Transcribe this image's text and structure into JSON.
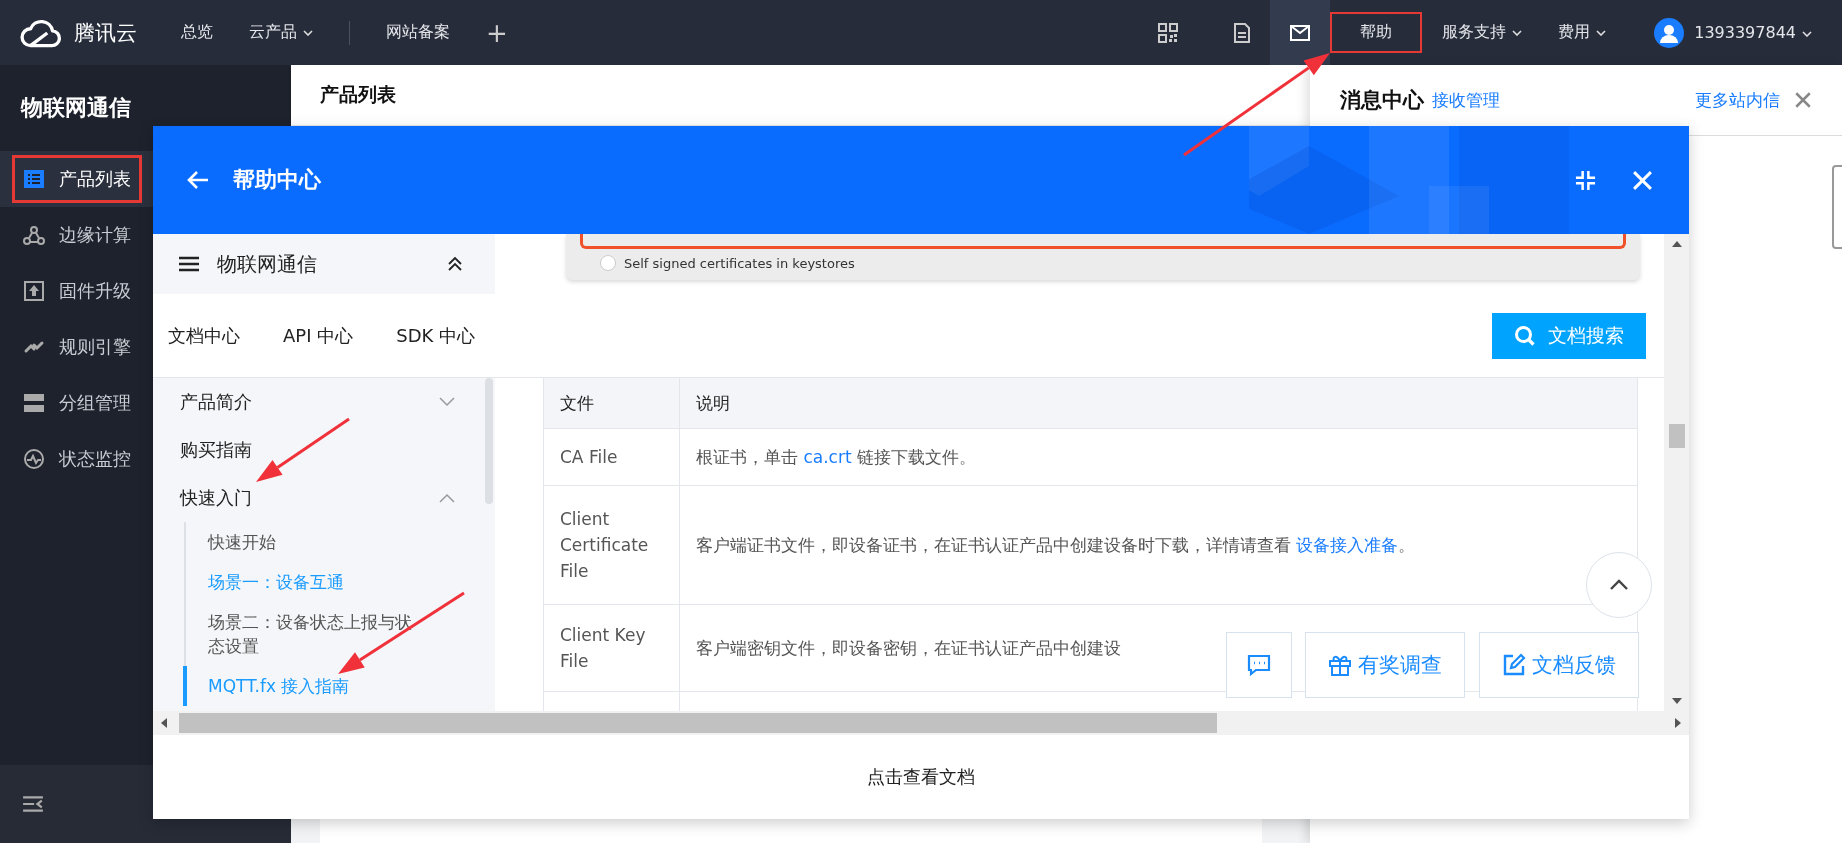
{
  "topbar": {
    "logo": "腾讯云",
    "nav": [
      {
        "label": "总览",
        "dropdown": false
      },
      {
        "label": "云产品",
        "dropdown": true
      }
    ],
    "links": [
      "网站备案"
    ],
    "add": "+",
    "menu": [
      {
        "label": "帮助",
        "dropdown": false,
        "marked": true
      },
      {
        "label": "服务支持",
        "dropdown": true,
        "marked": false
      },
      {
        "label": "费用",
        "dropdown": true,
        "marked": false
      }
    ],
    "account": {
      "name": "1393397844",
      "dropdown": true
    }
  },
  "sidebar": {
    "title": "物联网通信",
    "items": [
      {
        "label": "产品列表",
        "selected": true,
        "marked": true
      },
      {
        "label": "边缘计算",
        "selected": false,
        "marked": false
      },
      {
        "label": "固件升级",
        "selected": false,
        "marked": false
      },
      {
        "label": "规则引擎",
        "selected": false,
        "marked": false
      },
      {
        "label": "分组管理",
        "selected": false,
        "marked": false
      },
      {
        "label": "状态监控",
        "selected": false,
        "marked": false
      }
    ]
  },
  "main": {
    "title": "产品列表"
  },
  "messages": {
    "title": "消息中心",
    "manage": "接收管理",
    "more": "更多站内信"
  },
  "help": {
    "title": "帮助中心",
    "nav_header": "物联网通信",
    "image_option": {
      "label": "Self signed certificates in keystores",
      "checked": false
    },
    "tabs": [
      {
        "label": "文档中心"
      },
      {
        "label": "API 中心"
      },
      {
        "label": "SDK 中心"
      }
    ],
    "search": "文档搜索",
    "nav": [
      {
        "label": "产品简介",
        "expanded": false
      },
      {
        "label": "购买指南"
      },
      {
        "label": "快速入门",
        "expanded": true,
        "children": [
          {
            "label": "快速开始",
            "selected": false,
            "link": false
          },
          {
            "label": "场景一：设备互通",
            "selected": false,
            "link": true
          },
          {
            "label": "场景二：设备状态上报与状态设置",
            "selected": false,
            "link": false
          },
          {
            "label": "MQTT.fx 接入指南",
            "selected": true,
            "link": true
          }
        ]
      }
    ],
    "table": {
      "columns": [
        "文件",
        "说明"
      ],
      "rows": [
        {
          "file": "CA File",
          "desc": [
            {
              "text": "根证书，单击 ",
              "link": false
            },
            {
              "text": "ca.crt",
              "link": true
            },
            {
              "text": " 链接下载文件。",
              "link": false
            }
          ]
        },
        {
          "file": "Client Certificate File",
          "desc": [
            {
              "text": "客户端证书文件，即设备证书，在证书认证产品中创建设备时下载，详情请查看 ",
              "link": false
            },
            {
              "text": "设备接入准备",
              "link": true
            },
            {
              "text": "。",
              "link": false
            }
          ]
        },
        {
          "file": "Client Key File",
          "desc": [
            {
              "text": "客户端密钥文件，即设备密钥，在证书认证产品中创建设",
              "link": false
            }
          ]
        }
      ]
    },
    "float_buttons": [
      {
        "label": "有奖调查"
      },
      {
        "label": "文档反馈"
      }
    ],
    "footer": "点击查看文档"
  }
}
